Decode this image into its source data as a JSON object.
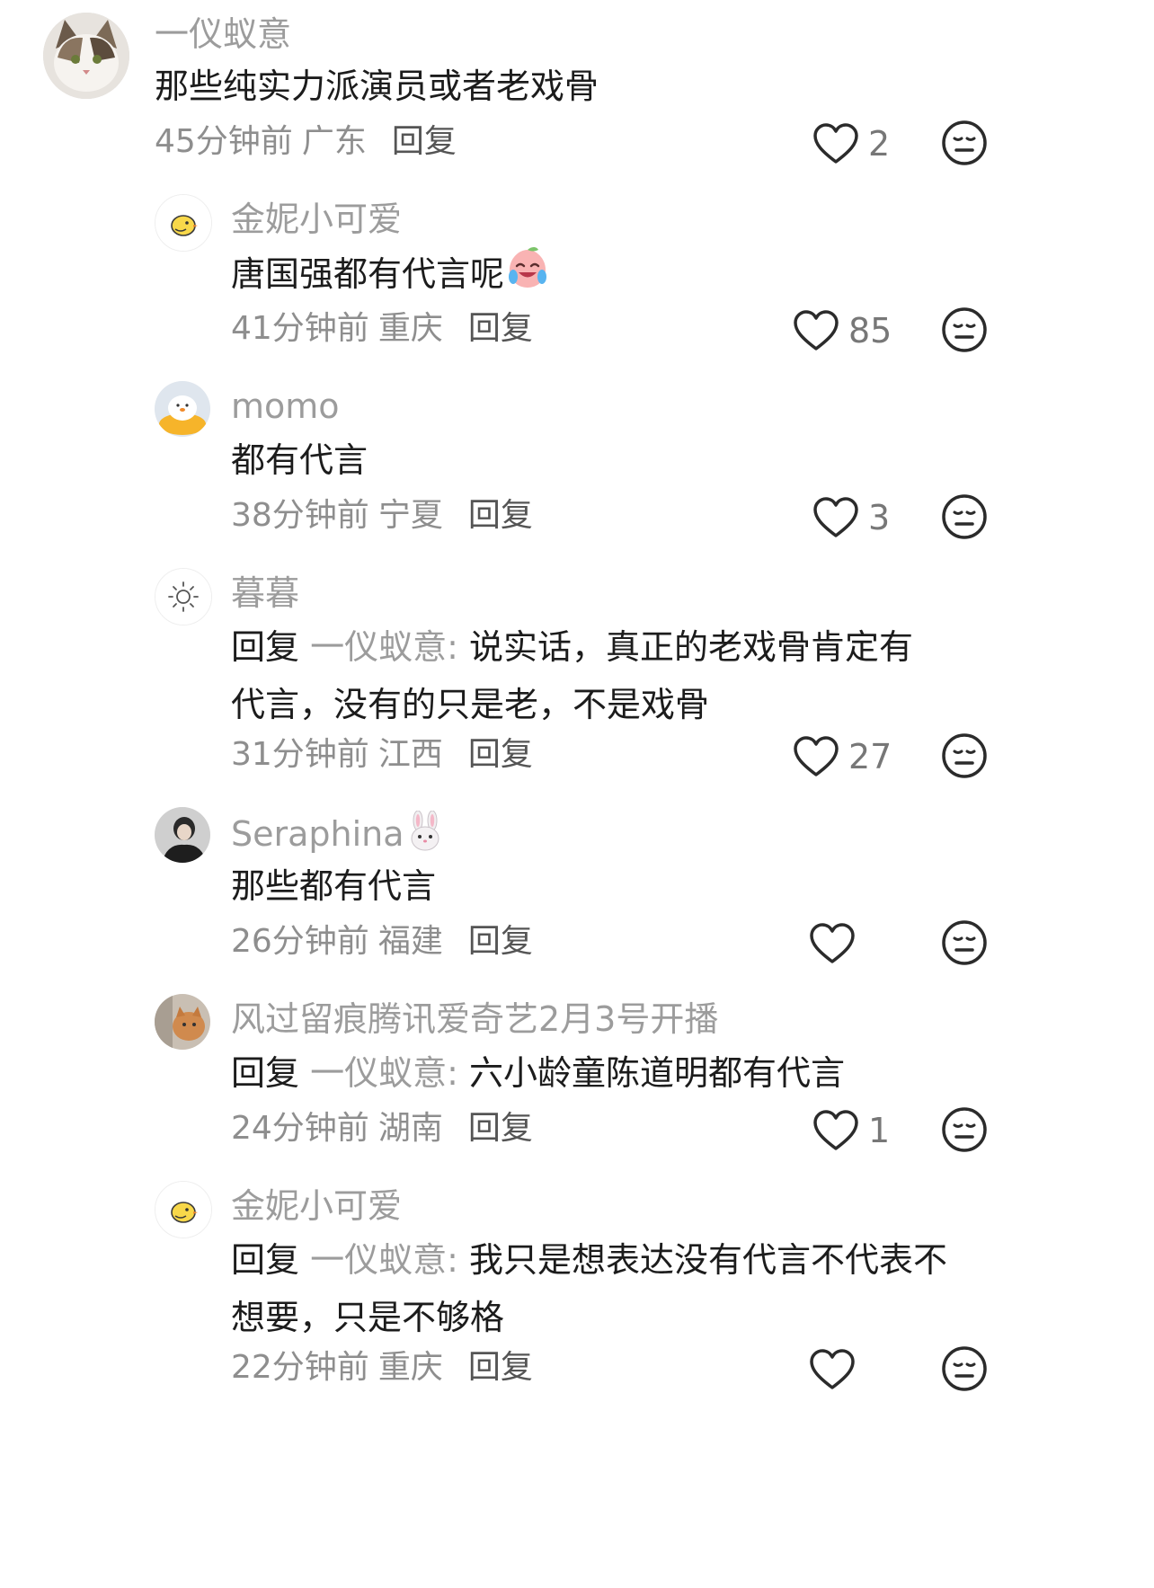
{
  "comments": [
    {
      "username": "一仪蚁意",
      "text": "那些纯实力派演员或者老戏骨",
      "time": "45分钟前",
      "location": "广东",
      "reply_label": "回复",
      "likes": "2",
      "avatar_icon": "cat-avatar-icon"
    },
    {
      "username": "金妮小可爱",
      "text": "唐国强都有代言呢",
      "emoji": "crying-laughing-peach-emoji",
      "time": "41分钟前",
      "location": "重庆",
      "reply_label": "回复",
      "likes": "85",
      "avatar_icon": "chick-avatar-icon"
    },
    {
      "username": "momo",
      "text": "都有代言",
      "time": "38分钟前",
      "location": "宁夏",
      "reply_label": "回复",
      "likes": "3",
      "avatar_icon": "duck-avatar-icon"
    },
    {
      "username": "暮暮",
      "reply_prefix": "回复",
      "reply_to": "一仪蚁意:",
      "text": "说实话，真正的老戏骨肯定有代言，没有的只是老，不是戏骨",
      "time": "31分钟前",
      "location": "江西",
      "reply_label": "回复",
      "likes": "27",
      "avatar_icon": "sun-avatar-icon"
    },
    {
      "username": "Seraphina",
      "name_emoji": "rabbit-face-emoji",
      "text": "那些都有代言",
      "time": "26分钟前",
      "location": "福建",
      "reply_label": "回复",
      "likes": "",
      "avatar_icon": "person-avatar-icon"
    },
    {
      "username": "风过留痕腾讯爱奇艺2月3号开播",
      "reply_prefix": "回复",
      "reply_to": "一仪蚁意:",
      "text": "六小龄童陈道明都有代言",
      "time": "24分钟前",
      "location": "湖南",
      "reply_label": "回复",
      "likes": "1",
      "avatar_icon": "cat-photo-avatar-icon"
    },
    {
      "username": "金妮小可爱",
      "reply_prefix": "回复",
      "reply_to": "一仪蚁意:",
      "text": "我只是想表达没有代言不代表不想要，只是不够格",
      "time": "22分钟前",
      "location": "重庆",
      "reply_label": "回复",
      "likes": "",
      "avatar_icon": "chick-avatar-icon"
    }
  ],
  "colors": {
    "name": "#9c9c9c",
    "text": "#1c1c1c",
    "meta": "#8e8e8e",
    "icon": "#2b2b2b"
  }
}
